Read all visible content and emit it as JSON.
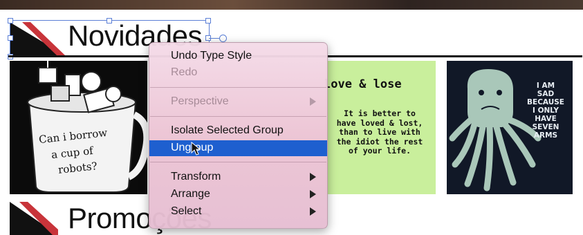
{
  "sections": {
    "novidades_title": "Novidades",
    "promocoes_title": "Promoções"
  },
  "products": {
    "mug": {
      "lines": [
        "Can i borrow",
        "a cup of",
        "robots?"
      ]
    },
    "poem": {
      "title": "love & lose",
      "lines": [
        "It is better to",
        "have loved & lost,",
        "than to live with",
        "the idiot the rest",
        "of your life."
      ]
    },
    "octopus": {
      "lines": [
        "I AM",
        "SAD",
        "BECAUSE",
        "I ONLY",
        "HAVE",
        "SEVEN",
        "ARMS"
      ]
    }
  },
  "context_menu": {
    "items": [
      {
        "label": "Undo Type Style",
        "enabled": true
      },
      {
        "label": "Redo",
        "enabled": false
      },
      {
        "label": "Perspective",
        "enabled": false,
        "submenu": true
      },
      {
        "label": "Isolate Selected Group",
        "enabled": true
      },
      {
        "label": "Ungroup",
        "enabled": true,
        "selected": true
      },
      {
        "label": "Transform",
        "enabled": true,
        "submenu": true
      },
      {
        "label": "Arrange",
        "enabled": true,
        "submenu": true
      },
      {
        "label": "Select",
        "enabled": true,
        "submenu": true
      }
    ]
  },
  "colors": {
    "selection": "#5b7fd6",
    "menu_highlight": "#1e5fcf",
    "accent_red": "#c8343a"
  },
  "icons": {
    "pointer": "arrow-cursor-icon",
    "submenu": "submenu-arrow-icon"
  }
}
